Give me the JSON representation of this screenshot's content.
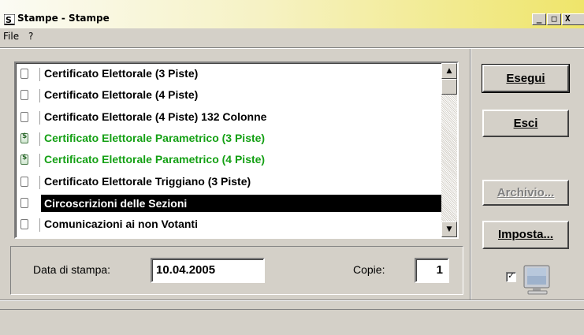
{
  "window": {
    "title": "Stampe - Stampe",
    "controls": {
      "minimize": "_",
      "maximize": "□",
      "close": "X"
    }
  },
  "menu": {
    "items": [
      "File",
      "?"
    ]
  },
  "list": {
    "items": [
      {
        "label": "Certificato Elettorale (3 Piste)",
        "color": "#000000",
        "icon": "document-icon"
      },
      {
        "label": "Certificato Elettorale (4 Piste)",
        "color": "#000000",
        "icon": "document-icon"
      },
      {
        "label": "Certificato Elettorale (4 Piste) 132 Colonne",
        "color": "#000000",
        "icon": "document-icon"
      },
      {
        "label": "Certificato Elettorale Parametrico (3 Piste)",
        "color": "#14a014",
        "icon": "parametric-document-icon"
      },
      {
        "label": "Certificato Elettorale Parametrico (4 Piste)",
        "color": "#14a014",
        "icon": "parametric-document-icon"
      },
      {
        "label": "Certificato Elettorale Triggiano (3 Piste)",
        "color": "#000000",
        "icon": "document-icon"
      },
      {
        "label": "Circoscrizioni delle Sezioni",
        "color": "#ffffff",
        "icon": "document-icon",
        "selected": true
      },
      {
        "label": "Comunicazioni ai non Votanti",
        "color": "#000000",
        "icon": "document-icon"
      }
    ]
  },
  "form": {
    "date_label": "Data di stampa:",
    "date_value": "10.04.2005",
    "copies_label": "Copie:",
    "copies_value": "1"
  },
  "buttons": {
    "run": "Esegui",
    "exit": "Esci",
    "archive": "Archivio...",
    "setup": "Imposta..."
  },
  "preview": {
    "checked": true,
    "icon": "monitor-icon"
  }
}
